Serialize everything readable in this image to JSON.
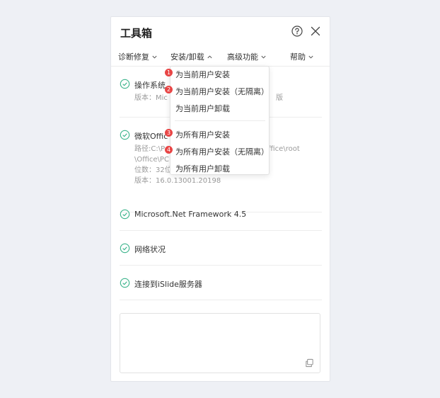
{
  "title": "工具箱",
  "icons": {
    "help": "help-circle-icon",
    "close": "close-icon",
    "check": "check-circle-icon",
    "copy": "copy-icon",
    "chevron": "chevron-icon"
  },
  "colors": {
    "accent": "#3cb48c",
    "badge": "#e84545",
    "background": "#eef0f5"
  },
  "menu": {
    "diagnose": "诊断修复",
    "install": "安装/卸载",
    "advanced": "高级功能",
    "help": "帮助"
  },
  "items": [
    {
      "title": "操作系统",
      "detail": [
        "版本：Mic",
        "版"
      ]
    },
    {
      "title": "微软Offic",
      "detail_left": [
        "路径:C:\\P",
        "\\Office\\PC",
        "位数：32位",
        "版本：16.0.13001.20198"
      ],
      "detail_right": "ffice\\root"
    },
    {
      "title": "Microsoft.Net Framework 4.5"
    },
    {
      "title": "网络状况"
    },
    {
      "title": "连接到iSlide服务器"
    }
  ],
  "dropdown": {
    "items": [
      {
        "badge": "1",
        "label": "为当前用户安装"
      },
      {
        "badge": "2",
        "label": "为当前用户安装（无隔离）"
      },
      {
        "badge": "",
        "label": "为当前用户卸载"
      },
      {
        "badge": "3",
        "label": "为所有用户安装"
      },
      {
        "badge": "4",
        "label": "为所有用户安装（无隔离）"
      },
      {
        "badge": "",
        "label": "为所有用户卸载"
      }
    ]
  }
}
